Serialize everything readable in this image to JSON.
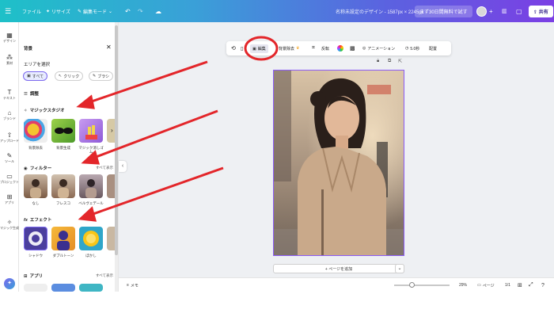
{
  "topbar": {
    "menu_icon": "hamburger-icon",
    "file": "ファイル",
    "resize": "リサイズ",
    "edit_mode": "編集モード",
    "doc_title": "名称未設定のデザイン - 1587px × 2245px",
    "trial": "まず30日間無料で試す",
    "share": "共有"
  },
  "rail": [
    {
      "icon": "design-icon",
      "label": "デザイン"
    },
    {
      "icon": "elements-icon",
      "label": "素材"
    },
    {
      "icon": "text-icon",
      "label": "テキスト"
    },
    {
      "icon": "brand-icon",
      "label": "ブランド"
    },
    {
      "icon": "upload-icon",
      "label": "アップロード"
    },
    {
      "icon": "draw-icon",
      "label": "ツール"
    },
    {
      "icon": "project-icon",
      "label": "プロジェクト"
    },
    {
      "icon": "apps-icon",
      "label": "アプリ"
    },
    {
      "icon": "magic-icon",
      "label": "マジック生成"
    }
  ],
  "panel": {
    "title": "背景",
    "select_area": "エリアを選択",
    "chips": [
      "すべて",
      "クリック",
      "ブラシ"
    ],
    "adjust": "調整",
    "magic_studio": "マジックスタジオ",
    "magic_items": [
      "背景除去",
      "背景生成",
      "マジック消しゴム"
    ],
    "filter": "フィルター",
    "filter_see_all": "すべて表示",
    "filter_items": [
      "なし",
      "フレスコ",
      "ベルヴェデール"
    ],
    "effect": "エフェクト",
    "effect_items": [
      "シャドウ",
      "ダブルトーン",
      "ぼかし"
    ],
    "apps": "アプリ",
    "apps_see_all": "すべて表示"
  },
  "toolbar": {
    "edit": "編集",
    "bg_remove": "背景除去",
    "flip": "反転",
    "animation": "アニメーション",
    "duration": "5.0秒",
    "position": "配置"
  },
  "canvas": {
    "add_page": "+ ページを追加"
  },
  "bottombar": {
    "notes": "メモ",
    "zoom": "29%",
    "pages_label": "ページ",
    "page_count": "1/1"
  },
  "colors": {
    "accent": "#8b5cf6",
    "arrow": "#e3262a"
  }
}
